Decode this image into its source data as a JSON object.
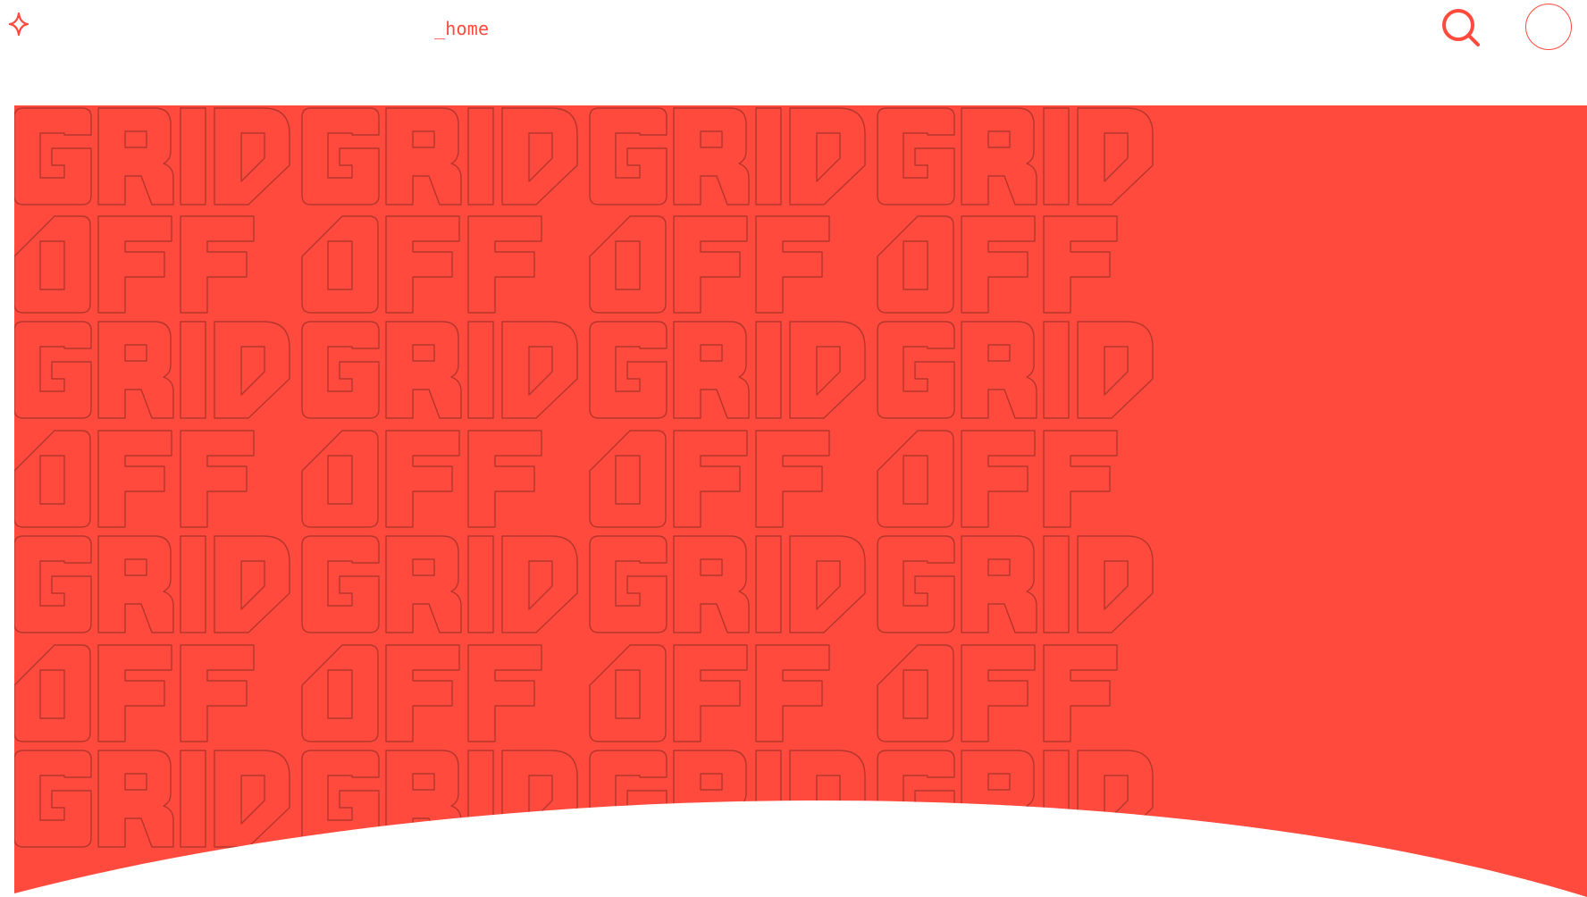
{
  "nav": {
    "logo": {
      "icon": "sparkle-icon",
      "color": "#ff4a3d"
    },
    "home_label": "_home",
    "search": {
      "icon": "search-icon",
      "color": "#ff4a3d"
    },
    "profile": {
      "icon": "profile-circle-icon",
      "color": "#ff4a3d"
    }
  },
  "hero": {
    "background": "#ff4a3d",
    "outline_color": "#b5362d",
    "pattern_words": [
      "GRID",
      "OFF"
    ]
  }
}
